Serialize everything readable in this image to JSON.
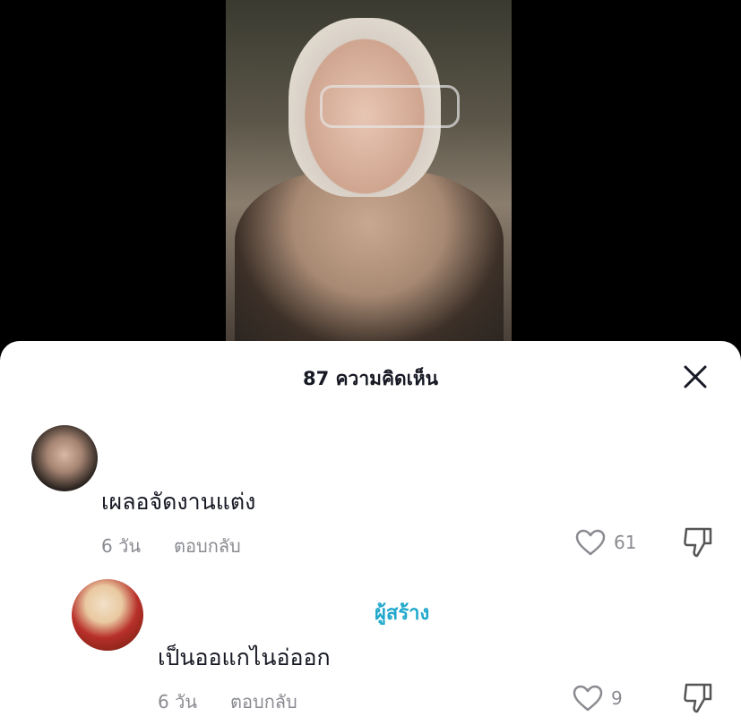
{
  "video": {
    "label": "video-preview"
  },
  "sheet": {
    "title": "87 ความคิดเห็น",
    "close_icon": "close-icon"
  },
  "comments": [
    {
      "text": "เผลอจัดงานแต่ง",
      "age": "6 วัน",
      "reply": "ตอบกลับ",
      "likes": "61"
    },
    {
      "badge": "ผู้สร้าง",
      "text": "เป็นออแกไนอ่ออก",
      "age": "6 วัน",
      "reply": "ตอบกลับ",
      "likes": "9"
    }
  ],
  "colors": {
    "accent": "#20a8cc",
    "muted": "#8a8b91",
    "text": "#161823"
  }
}
